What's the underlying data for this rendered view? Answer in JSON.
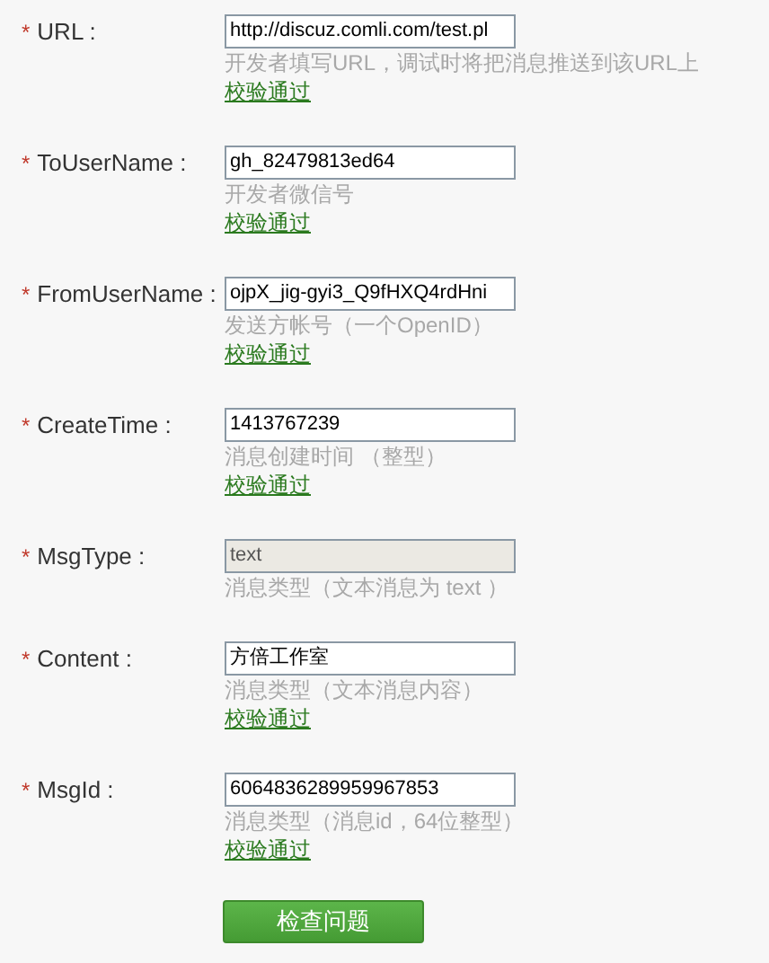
{
  "fields": [
    {
      "label": "URL :",
      "required_mark": "*",
      "value": "http://discuz.comli.com/test.pl",
      "disabled": false,
      "hint": "开发者填写URL，调试时将把消息推送到该URL上",
      "status": "校验通过"
    },
    {
      "label": "ToUserName :",
      "required_mark": "*",
      "value": "gh_82479813ed64",
      "disabled": false,
      "hint": "开发者微信号",
      "status": "校验通过"
    },
    {
      "label": "FromUserName :",
      "required_mark": "*",
      "value": "ojpX_jig-gyi3_Q9fHXQ4rdHni",
      "disabled": false,
      "hint": "发送方帐号（一个OpenID）",
      "status": "校验通过"
    },
    {
      "label": "CreateTime :",
      "required_mark": "*",
      "value": "1413767239",
      "disabled": false,
      "hint": "消息创建时间 （整型）",
      "status": "校验通过"
    },
    {
      "label": "MsgType :",
      "required_mark": "*",
      "value": "text",
      "disabled": true,
      "hint": "消息类型（文本消息为 text ）"
    },
    {
      "label": "Content :",
      "required_mark": "*",
      "value": "方倍工作室",
      "disabled": false,
      "hint": "消息类型（文本消息内容）",
      "status": "校验通过"
    },
    {
      "label": "MsgId :",
      "required_mark": "*",
      "value": "6064836289959967853",
      "disabled": false,
      "hint": "消息类型（消息id，64位整型）",
      "status": "校验通过"
    }
  ],
  "submit": "检查问题"
}
